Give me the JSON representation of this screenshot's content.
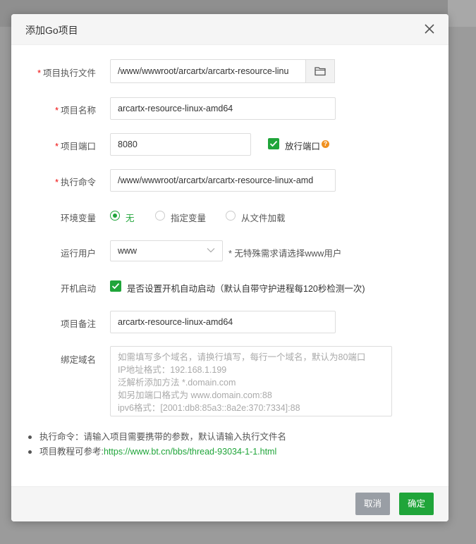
{
  "dialog": {
    "title": "添加Go项目"
  },
  "form": {
    "exec_file": {
      "label": "项目执行文件",
      "value": "/www/wwwroot/arcartx/arcartx-resource-linu"
    },
    "project_name": {
      "label": "项目名称",
      "value": "arcartx-resource-linux-amd64"
    },
    "project_port": {
      "label": "项目端口",
      "value": "8080",
      "open_port_label": "放行端口",
      "open_port_checked": true,
      "help": "?"
    },
    "exec_command": {
      "label": "执行命令",
      "value": "/www/wwwroot/arcartx/arcartx-resource-linux-amd"
    },
    "env_vars": {
      "label": "环境变量",
      "options": [
        "无",
        "指定变量",
        "从文件加载"
      ],
      "selected": "无"
    },
    "run_user": {
      "label": "运行用户",
      "value": "www",
      "hint": "* 无特殊需求请选择www用户"
    },
    "autostart": {
      "label": "开机启动",
      "checked": true,
      "text": "是否设置开机自动启动（默认自带守护进程每120秒检测一次)"
    },
    "remark": {
      "label": "项目备注",
      "value": "arcartx-resource-linux-amd64"
    },
    "domains": {
      "label": "绑定域名",
      "placeholder_lines": [
        "如需填写多个域名，请换行填写，每行一个域名，默认为80端口",
        "IP地址格式：192.168.1.199",
        "泛解析添加方法 *.domain.com",
        "如另加端口格式为 www.domain.com:88",
        "ipv6格式：[2001:db8:85a3::8a2e:370:7334]:88"
      ]
    }
  },
  "tips": {
    "tip1": "执行命令：请输入项目需要携带的参数，默认请输入执行文件名",
    "tip2_prefix": "项目教程可参考:",
    "tip2_link": "https://www.bt.cn/bbs/thread-93034-1-1.html"
  },
  "footer": {
    "cancel": "取消",
    "confirm": "确定"
  },
  "colors": {
    "accent": "#20a53a",
    "required": "#ef0808",
    "help": "#f0901f"
  }
}
